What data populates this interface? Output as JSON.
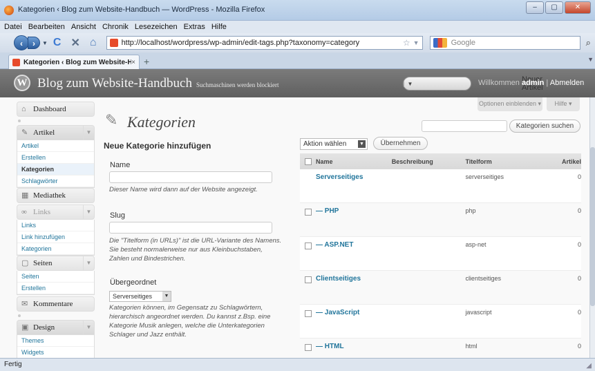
{
  "window": {
    "title": "Kategorien ‹ Blog zum Website-Handbuch — WordPress - Mozilla Firefox",
    "btn_min": "–",
    "btn_max": "▢",
    "btn_close": "✕"
  },
  "menubar": [
    "Datei",
    "Bearbeiten",
    "Ansicht",
    "Chronik",
    "Lesezeichen",
    "Extras",
    "Hilfe"
  ],
  "nav": {
    "url": "http://localhost/wordpress/wp-admin/edit-tags.php?taxonomy=category",
    "search_provider": "Google"
  },
  "tab": {
    "label": "Kategorien ‹ Blog zum Website-Hand...",
    "close": "×",
    "new": "+"
  },
  "wp": {
    "blog_title": "Blog zum Website-Handbuch",
    "blog_sub": "Suchmaschinen werden blockiert",
    "new_post": "Neuer Artikel",
    "greeting_prefix": "Willkommen ",
    "user": "admin",
    "separator": " | ",
    "logout": "Abmelden",
    "screen_options": "Optionen einblenden ▾",
    "help": "Hilfe ▾"
  },
  "sidebar": {
    "dashboard": "Dashboard",
    "artikel": "Artikel",
    "artikel_items": [
      "Artikel",
      "Erstellen",
      "Kategorien",
      "Schlagwörter"
    ],
    "mediathek": "Mediathek",
    "links": "Links",
    "links_items": [
      "Links",
      "Link hinzufügen",
      "Kategorien"
    ],
    "seiten": "Seiten",
    "seiten_items": [
      "Seiten",
      "Erstellen"
    ],
    "kommentare": "Kommentare",
    "design": "Design",
    "design_items": [
      "Themes",
      "Widgets"
    ]
  },
  "page": {
    "title": "Kategorien",
    "search_btn": "Kategorien suchen",
    "form_title": "Neue Kategorie hinzufügen",
    "name_label": "Name",
    "name_hint": "Dieser Name wird dann auf der Website angezeigt.",
    "slug_label": "Slug",
    "slug_hint": "Die \"Titelform (in URLs)\" ist die URL-Variante des Namens. Sie besteht normalerweise nur aus Kleinbuchstaben, Zahlen und Bindestrichen.",
    "parent_label": "Übergeordnet",
    "parent_value": "Serverseitiges",
    "parent_hint": "Kategorien können, im Gegensatz zu Schlagwörtern, hierarchisch angeordnet werden. Du kannst z.Bsp. eine Kategorie Musik anlegen, welche die Unterkategorien Schlager und Jazz enthält."
  },
  "table": {
    "bulk_action": "Aktion wählen",
    "apply": "Übernehmen",
    "headers": {
      "name": "Name",
      "desc": "Beschreibung",
      "slug": "Titelform",
      "count": "Artikel"
    },
    "rows": [
      {
        "name": "Serverseitiges",
        "slug": "serverseitiges",
        "count": "0"
      },
      {
        "name": "— PHP",
        "slug": "php",
        "count": "0"
      },
      {
        "name": "— ASP.NET",
        "slug": "asp-net",
        "count": "0"
      },
      {
        "name": "Clientseitiges",
        "slug": "clientseitiges",
        "count": "0"
      },
      {
        "name": "— JavaScript",
        "slug": "javascript",
        "count": "0"
      },
      {
        "name": "— HTML",
        "slug": "html",
        "count": "0"
      }
    ]
  },
  "status": "Fertig"
}
